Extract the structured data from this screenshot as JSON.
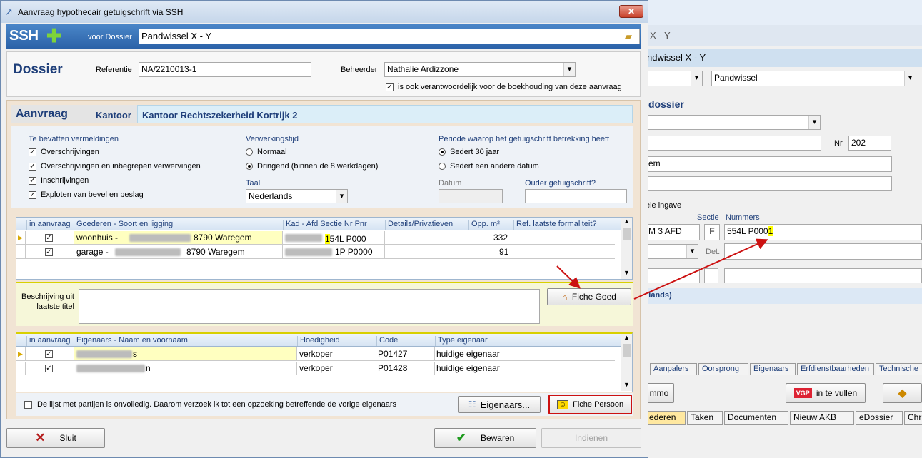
{
  "window": {
    "title": "Aanvraag hypothecair getuigschrift via SSH",
    "close_label": "✕"
  },
  "header": {
    "logo": "SSH",
    "voor_dossier_label": "voor Dossier",
    "dossier_value": "Pandwissel X - Y"
  },
  "dossier": {
    "title": "Dossier",
    "referentie_label": "Referentie",
    "referentie_value": "NA/2210013-1",
    "beheerder_label": "Beheerder",
    "beheerder_value": "Nathalie Ardizzone",
    "verantwoordelijk_label": "is ook verantwoordelijk voor de boekhouding van deze aanvraag"
  },
  "aanvraag": {
    "title": "Aanvraag",
    "kantoor_label": "Kantoor",
    "kantoor_value": "Kantoor Rechtszekerheid Kortrijk 2",
    "vermeldingen_title": "Te bevatten vermeldingen",
    "vermeldingen": [
      "Overschrijvingen",
      "Overschrijvingen en inbegrepen verwervingen",
      "Inschrijvingen",
      "Exploten van bevel en beslag"
    ],
    "verwerkingstijd_title": "Verwerkingstijd",
    "verwerkingstijd": [
      "Normaal",
      "Dringend (binnen de 8 werkdagen)"
    ],
    "taal_label": "Taal",
    "taal_value": "Nederlands",
    "periode_title": "Periode waarop het getuigschrift betrekking heeft",
    "periode": [
      "Sedert 30 jaar",
      "Sedert een andere datum"
    ],
    "datum_label": "Datum",
    "ouder_label": "Ouder getuigschrift?"
  },
  "goederen": {
    "columns": [
      "in aanvraag",
      "Goederen - Soort en ligging",
      "Kad - Afd Sectie Nr Pnr",
      "Details/Privatieven",
      "Opp. m²",
      "Ref. laatste formaliteit?"
    ],
    "rows": [
      {
        "soort": "woonhuis  -",
        "plaats": "8790 Waregem",
        "kad": "554L P000",
        "kad_hl": "1",
        "opp": "332"
      },
      {
        "soort": "garage  -",
        "plaats": "8790 Waregem",
        "kad": "1P P0000",
        "kad_hl": "",
        "opp": "91"
      }
    ],
    "beschrijving_label": "Beschrijving uit laatste titel",
    "fiche_goed_label": "Fiche Goed"
  },
  "eigenaars": {
    "columns": [
      "in aanvraag",
      "Eigenaars - Naam en voornaam",
      "Hoedigheid",
      "Code",
      "Type eigenaar"
    ],
    "rows": [
      {
        "naam": "s",
        "hoed": "verkoper",
        "code": "P01427",
        "type": "huidige eigenaar"
      },
      {
        "naam": "n",
        "hoed": "verkoper",
        "code": "P01428",
        "type": "huidige eigenaar"
      }
    ],
    "onvolledig_label": "De lijst met partijen is onvolledig. Daarom verzoek ik tot een opzoeking betreffende de vorige eigenaars",
    "eigenaars_btn": "Eigenaars...",
    "fiche_persoon_btn": "Fiche Persoon"
  },
  "footer": {
    "sluit": "Sluit",
    "bewaren": "Bewaren",
    "indienen": "Indienen"
  },
  "background": {
    "title_frag": "X - Y",
    "dossier_frag": "ndwissel X - Y",
    "select_value": "Pandwissel",
    "dossier_label": "dossier",
    "nr_label": "Nr",
    "nr_value": "202",
    "gem_frag": "em",
    "ingave_label": "ele ingave",
    "sectie_label": "Sectie",
    "nummers_label": "Nummers",
    "afd_value": "M  3 AFD",
    "sectie_value": "F",
    "nummers_value": "554L P000",
    "nummers_hl": "1",
    "det_label": "Det.",
    "lands_label": "rlands)",
    "tabs_top": [
      "Aanpalers",
      "Oorsprong",
      "Eigenaars",
      "Erfdienstbaarheden",
      "Technische"
    ],
    "immo_btn": "mmo",
    "vgp_label": "VGP",
    "invullen_btn": "in te vullen",
    "tabs_bottom": [
      "ederen",
      "Taken",
      "Documenten",
      "Nieuw AKB",
      "eDossier",
      "Chr"
    ]
  },
  "colors": {
    "accent": "#2f5fa5",
    "highlight": "#ffff00",
    "row_selected": "#ffffc0",
    "arrow": "#cc1111"
  }
}
